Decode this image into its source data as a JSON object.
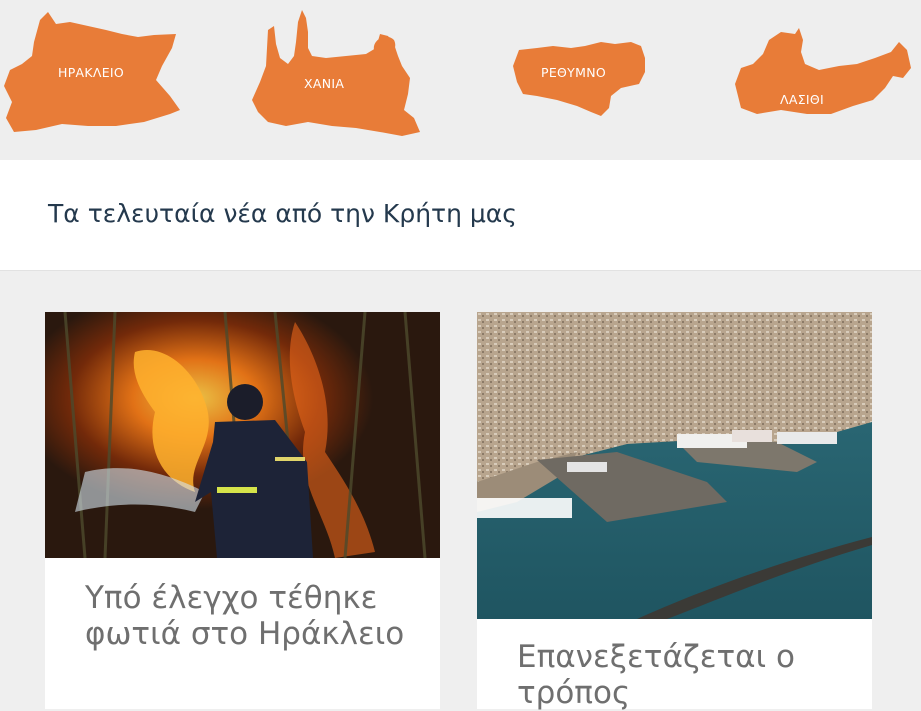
{
  "regions": [
    {
      "label": "ΗΡΑΚΛΕΙΟ",
      "color": "#e87c38"
    },
    {
      "label": "ΧΑΝΙΑ",
      "color": "#e87c38"
    },
    {
      "label": "ΡΕΘΥΜΝΟ",
      "color": "#e87c38"
    },
    {
      "label": "ΛΑΣΙΘΙ",
      "color": "#e87c38"
    }
  ],
  "section": {
    "heading": "Τα τελευταία νέα από την Κρήτη μας"
  },
  "articles": [
    {
      "title": "Υπό έλεγχο τέθηκε φωτιά στο Ηράκλειο"
    },
    {
      "title": "Επανεξετάζεται ο τρόπος"
    }
  ]
}
